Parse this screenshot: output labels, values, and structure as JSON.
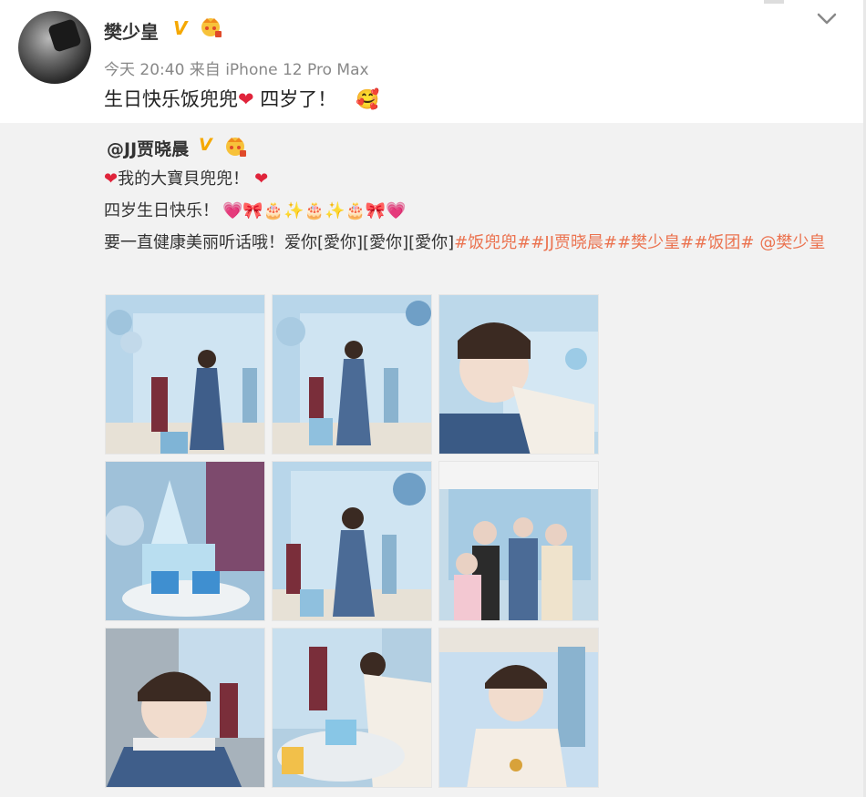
{
  "post": {
    "username": "樊少皇",
    "verified_badge": "V",
    "meta": "今天 20:40 来自 iPhone 12 Pro Max",
    "text_part1": "生日快乐饭兜兜",
    "text_heart": "❤",
    "text_part2": " 四岁了！",
    "emoji": "🥰"
  },
  "repost": {
    "username": "@JJ贾晓晨",
    "verified_badge": "V",
    "line1_heart_left": "❤",
    "line1_text": "我的大寶貝兜兜！",
    "line1_heart_right": "❤",
    "line2_text": "四岁生日快乐！",
    "line2_emojis": "💗🎀🎂✨🎂✨🎂🎀💗",
    "line3_text": "要一直健康美丽听话哦！爱你[愛你][愛你][愛你]",
    "line3_tags": "#饭兜兜##JJ贾晓晨##樊少皇##饭团#",
    "line3_mention": "@樊少皇"
  },
  "photos": [
    "party-photo-1",
    "party-photo-2",
    "party-photo-3",
    "party-photo-4",
    "party-photo-5",
    "party-photo-6",
    "party-photo-7",
    "party-photo-8",
    "party-photo-9"
  ],
  "icons": {
    "chevron": "chevron-down-icon",
    "crown": "member-crown-icon"
  },
  "colors": {
    "tag": "#eb7350",
    "verified": "#f5a800",
    "heart": "#e0243b",
    "repost_bg": "#f2f2f2"
  }
}
